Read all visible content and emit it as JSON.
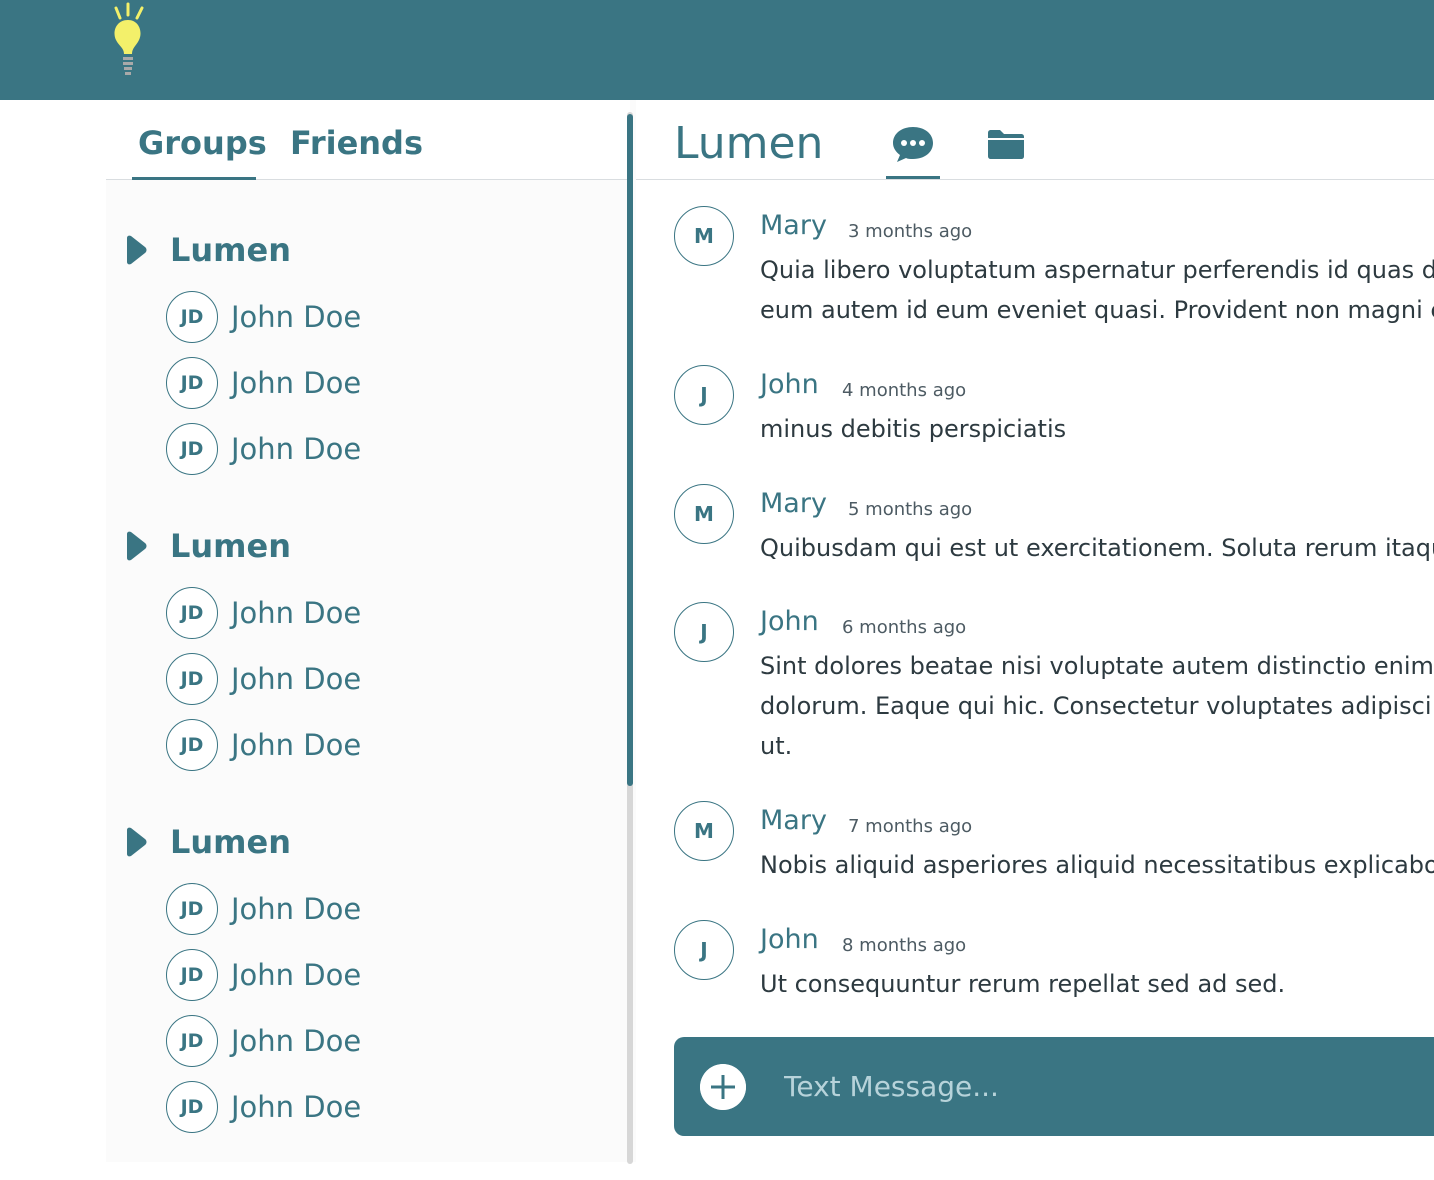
{
  "colors": {
    "primary": "#3a7583",
    "sidebar_bg": "#fbfbfb",
    "bulb": "#f3f06a"
  },
  "sidebar": {
    "tabs": [
      "Groups",
      "Friends"
    ],
    "active_tab": "Groups",
    "groups": [
      {
        "name": "Lumen",
        "members": [
          {
            "initials": "JD",
            "name": "John Doe"
          },
          {
            "initials": "JD",
            "name": "John Doe"
          },
          {
            "initials": "JD",
            "name": "John Doe"
          }
        ]
      },
      {
        "name": "Lumen",
        "members": [
          {
            "initials": "JD",
            "name": "John Doe"
          },
          {
            "initials": "JD",
            "name": "John Doe"
          },
          {
            "initials": "JD",
            "name": "John Doe"
          }
        ]
      },
      {
        "name": "Lumen",
        "members": [
          {
            "initials": "JD",
            "name": "John Doe"
          },
          {
            "initials": "JD",
            "name": "John Doe"
          },
          {
            "initials": "JD",
            "name": "John Doe"
          },
          {
            "initials": "JD",
            "name": "John Doe"
          }
        ]
      }
    ]
  },
  "chat": {
    "title": "Lumen",
    "tab_icons": [
      "chat-bubble-icon",
      "folder-icon"
    ],
    "active_tab_icon": "chat-bubble-icon",
    "messages": [
      {
        "initial": "M",
        "author": "Mary",
        "time": "3 months ago",
        "lines": [
          "Quia libero voluptatum aspernatur perferendis id quas dol",
          "eum autem id eum eveniet quasi. Provident non magni est"
        ]
      },
      {
        "initial": "J",
        "author": "John",
        "time": "4 months ago",
        "lines": [
          "minus debitis perspiciatis"
        ]
      },
      {
        "initial": "M",
        "author": "Mary",
        "time": "5 months ago",
        "lines": [
          "Quibusdam qui est ut exercitationem. Soluta rerum itaque"
        ]
      },
      {
        "initial": "J",
        "author": "John",
        "time": "6 months ago",
        "lines": [
          "Sint dolores beatae nisi voluptate autem distinctio enim vo",
          "dolorum. Eaque qui hic. Consectetur voluptates adipisci id",
          "ut."
        ]
      },
      {
        "initial": "M",
        "author": "Mary",
        "time": "7 months ago",
        "lines": [
          "Nobis aliquid asperiores aliquid necessitatibus explicabo."
        ]
      },
      {
        "initial": "J",
        "author": "John",
        "time": "8 months ago",
        "lines": [
          "Ut consequuntur rerum repellat sed ad sed."
        ]
      }
    ]
  },
  "composer": {
    "placeholder": "Text Message...",
    "value": ""
  }
}
